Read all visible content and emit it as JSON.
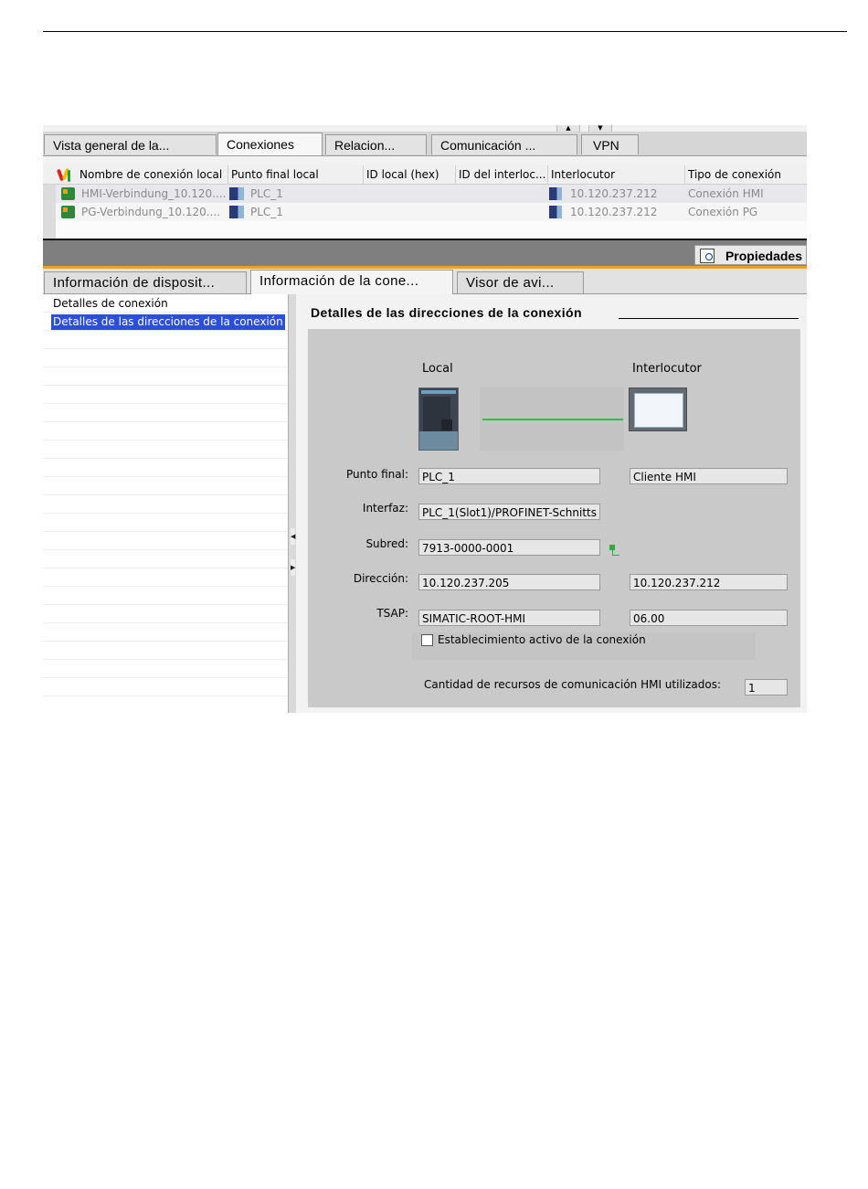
{
  "top_tabs": [
    "Vista general de la...",
    "Conexiones",
    "Relacion...",
    "Comunicación ...",
    "VPN"
  ],
  "table": {
    "columns": [
      "Nombre de conexión local",
      "Punto final local",
      "ID local (hex)",
      "ID del interloc...",
      "Interlocutor",
      "Tipo de conexión"
    ],
    "rows": [
      {
        "name": "HMI-Verbindung_10.120....",
        "endpoint": "PLC_1",
        "local_id": "",
        "partner_id": "",
        "partner": "10.120.237.212",
        "type": "Conexión HMI"
      },
      {
        "name": "PG-Verbindung_10.120....",
        "endpoint": "PLC_1",
        "local_id": "",
        "partner_id": "",
        "partner": "10.120.237.212",
        "type": "Conexión PG"
      }
    ]
  },
  "properties_button": "Propiedades",
  "prop_tabs": [
    "Información de disposit...",
    "Información de la cone...",
    "Visor de avi..."
  ],
  "nav": {
    "items": [
      "Detalles de conexión",
      "Detalles de las direcciones de la conexión"
    ],
    "selected_index": 1
  },
  "details": {
    "title": "Detalles de las direcciones de la conexión",
    "local_header": "Local",
    "partner_header": "Interlocutor",
    "labels": {
      "endpoint": "Punto final:",
      "interface": "Interfaz:",
      "subnet": "Subred:",
      "address": "Dirección:",
      "tsap": "TSAP:"
    },
    "local": {
      "endpoint": "PLC_1",
      "interface": "PLC_1(Slot1)/PROFINET-Schnitts",
      "subnet": "7913-0000-0001",
      "address": "10.120.237.205",
      "tsap": "SIMATIC-ROOT-HMI"
    },
    "partner": {
      "endpoint": "Cliente HMI",
      "address": "10.120.237.212",
      "tsap": "06.00"
    },
    "active_connection_label": "Establecimiento activo de la conexión",
    "active_connection_checked": false,
    "hmi_resources_label": "Cantidad de recursos de comunicación HMI utilizados:",
    "hmi_resources_value": "1"
  },
  "colors": {
    "selection": "#2a4fd8",
    "link_line": "#1ec83c",
    "accent_orange": "#f0a020"
  }
}
